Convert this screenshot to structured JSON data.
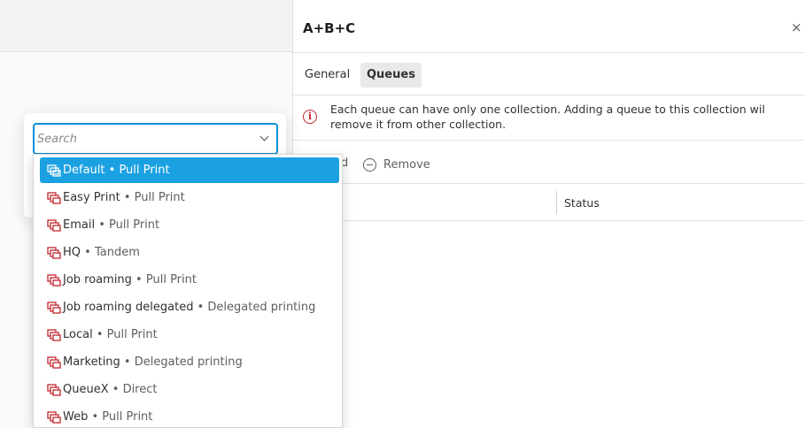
{
  "panel": {
    "title": "A+B+C",
    "close_glyph": "×",
    "tabs": [
      {
        "label": "General",
        "active": false
      },
      {
        "label": "Queues",
        "active": true
      }
    ],
    "notice": {
      "icon": "info-icon",
      "line1": "Each queue can have only one collection. Adding a queue to this collection wil",
      "line2": "remove it from other collection."
    },
    "toolbar": {
      "add_fragment": "d",
      "remove_label": "Remove"
    },
    "table": {
      "columns": [
        "Status"
      ]
    }
  },
  "search": {
    "placeholder": "Search",
    "value": ""
  },
  "dropdown": {
    "separator": "•",
    "options": [
      {
        "name": "Default",
        "type": "Pull Print",
        "selected": true
      },
      {
        "name": "Easy Print",
        "type": "Pull Print",
        "selected": false
      },
      {
        "name": "Email",
        "type": "Pull Print",
        "selected": false
      },
      {
        "name": "HQ",
        "type": "Tandem",
        "selected": false
      },
      {
        "name": "Job roaming",
        "type": "Pull Print",
        "selected": false
      },
      {
        "name": "Job roaming delegated",
        "type": "Delegated printing",
        "selected": false
      },
      {
        "name": "Local",
        "type": "Pull Print",
        "selected": false
      },
      {
        "name": "Marketing",
        "type": "Delegated printing",
        "selected": false
      },
      {
        "name": "QueueX",
        "type": "Direct",
        "selected": false
      },
      {
        "name": "Web",
        "type": "Pull Print",
        "selected": false
      }
    ]
  },
  "colors": {
    "accent": "#1ba1e2",
    "focus_border": "#0f8fd8",
    "icon_red": "#c4262e"
  }
}
